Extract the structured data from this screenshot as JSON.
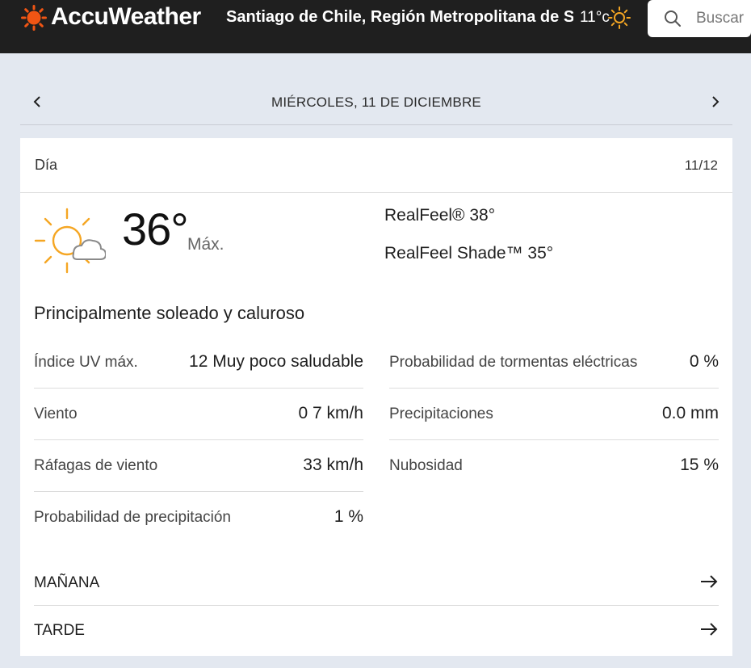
{
  "header": {
    "brand": "AccuWeather",
    "location": "Santiago de Chile, Región Metropolitana de S...",
    "current_temp": "11°c",
    "search_placeholder": "Buscar"
  },
  "date_nav": {
    "title": "MIÉRCOLES, 11 DE DICIEMBRE"
  },
  "card": {
    "title": "Día",
    "date": "11/12",
    "temperature": "36°",
    "temp_label": "Máx.",
    "realfeel": "RealFeel® 38°",
    "realfeel_shade": "RealFeel Shade™ 35°",
    "phrase": "Principalmente soleado y caluroso",
    "left_stats": [
      {
        "label": "Índice UV máx.",
        "value": "12 Muy poco saludable"
      },
      {
        "label": "Viento",
        "value": "0 7 km/h"
      },
      {
        "label": "Ráfagas de viento",
        "value": "33 km/h"
      },
      {
        "label": "Probabilidad de precipitación",
        "value": "1 %"
      }
    ],
    "right_stats": [
      {
        "label": "Probabilidad de tormentas eléctricas",
        "value": "0 %"
      },
      {
        "label": "Precipitaciones",
        "value": "0.0 mm"
      },
      {
        "label": "Nubosidad",
        "value": "15 %"
      }
    ],
    "sections": [
      {
        "label": "MAÑANA"
      },
      {
        "label": "TARDE"
      }
    ]
  },
  "colors": {
    "header_bg": "#1f1f1f",
    "accent_orange": "#f05514",
    "sun_orange": "#f5a623",
    "page_bg": "#e3e8f0"
  },
  "icons": {
    "logo": "accuweather-sun-icon",
    "current": "sun-icon",
    "weather": "mostly-sunny-icon"
  }
}
